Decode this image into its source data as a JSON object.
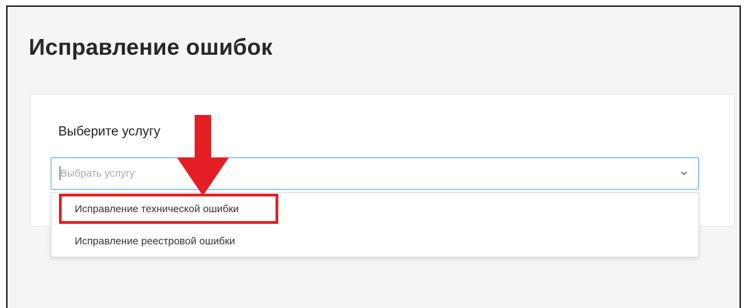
{
  "page": {
    "title": "Исправление ошибок"
  },
  "form": {
    "label": "Выберите услугу",
    "select": {
      "placeholder": "Выбрать услугу",
      "accent_color": "#4aa3df"
    },
    "options": [
      {
        "label": "Исправление технической ошибки",
        "highlighted": true
      },
      {
        "label": "Исправление реестровой ошибки",
        "highlighted": false
      }
    ]
  },
  "annotation": {
    "color": "#e31e24",
    "arrow_icon": "down-arrow-icon"
  }
}
